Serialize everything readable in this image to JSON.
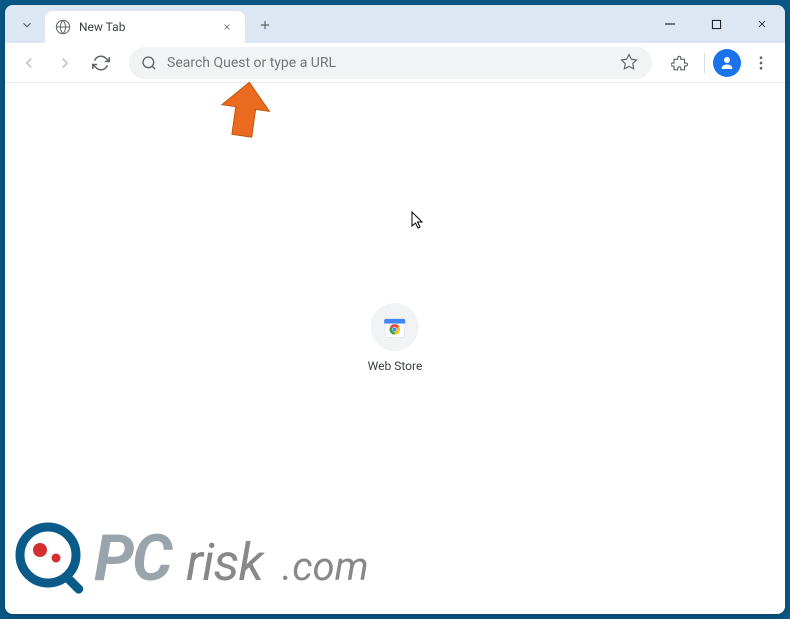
{
  "tab": {
    "title": "New Tab"
  },
  "omnibox": {
    "placeholder": "Search Quest or type a URL"
  },
  "shortcut": {
    "label": "Web Store"
  },
  "watermark": {
    "text": "PCrisk.com"
  },
  "colors": {
    "frame": "#0a5a8a",
    "tabstrip": "#dde7f4",
    "arrow": "#ea6b1f",
    "accent": "#1a73e8"
  }
}
